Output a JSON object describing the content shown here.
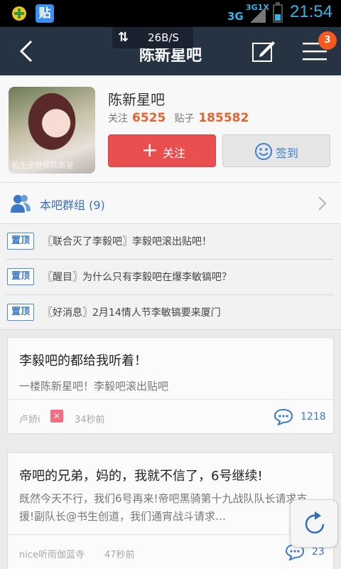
{
  "status_bar": {
    "net_small": "3G1X",
    "net_big": "3G",
    "time": "21:54",
    "tieba_icon_text": "贴"
  },
  "nav": {
    "title": "陈新星吧",
    "traffic": "26B/S",
    "badge": "3"
  },
  "forum": {
    "name": "陈新星吧",
    "follow_label": "关注",
    "follow_count": "6525",
    "posts_label": "贴子",
    "posts_count": "185582",
    "follow_button": "关注",
    "sign_button": "签到",
    "group_label": "本吧群组 (9)",
    "avatar_watermark": "若生于世择陈新星"
  },
  "top_threads": [
    {
      "tag": "置顶",
      "text": "〖联合灭了李毅吧〗李毅吧滚出贴吧！"
    },
    {
      "tag": "置顶",
      "text": "〖醒目〗为什么只有李毅吧在爆李敏镐吧？"
    },
    {
      "tag": "置顶",
      "text": "〖好消息〗2月14情人节李敏镐要来厦门"
    }
  ],
  "posts": [
    {
      "title": "李毅吧的都给我听着！",
      "excerpt": "一楼陈新星吧！李毅吧滚出贴吧",
      "author": "卢娇i",
      "time": "34秒前",
      "comments": "1218"
    },
    {
      "title": "帝吧的兄弟，妈的，我就不信了，6号继续!",
      "excerpt": "既然今天不行，我们6号再来!帝吧黑骑第十九战队队长请求支援!副队长@书生创道，我们通宵战斗请求…",
      "author": "nice听雨伽蓝寺",
      "time": "47秒前",
      "comments": "23"
    }
  ]
}
